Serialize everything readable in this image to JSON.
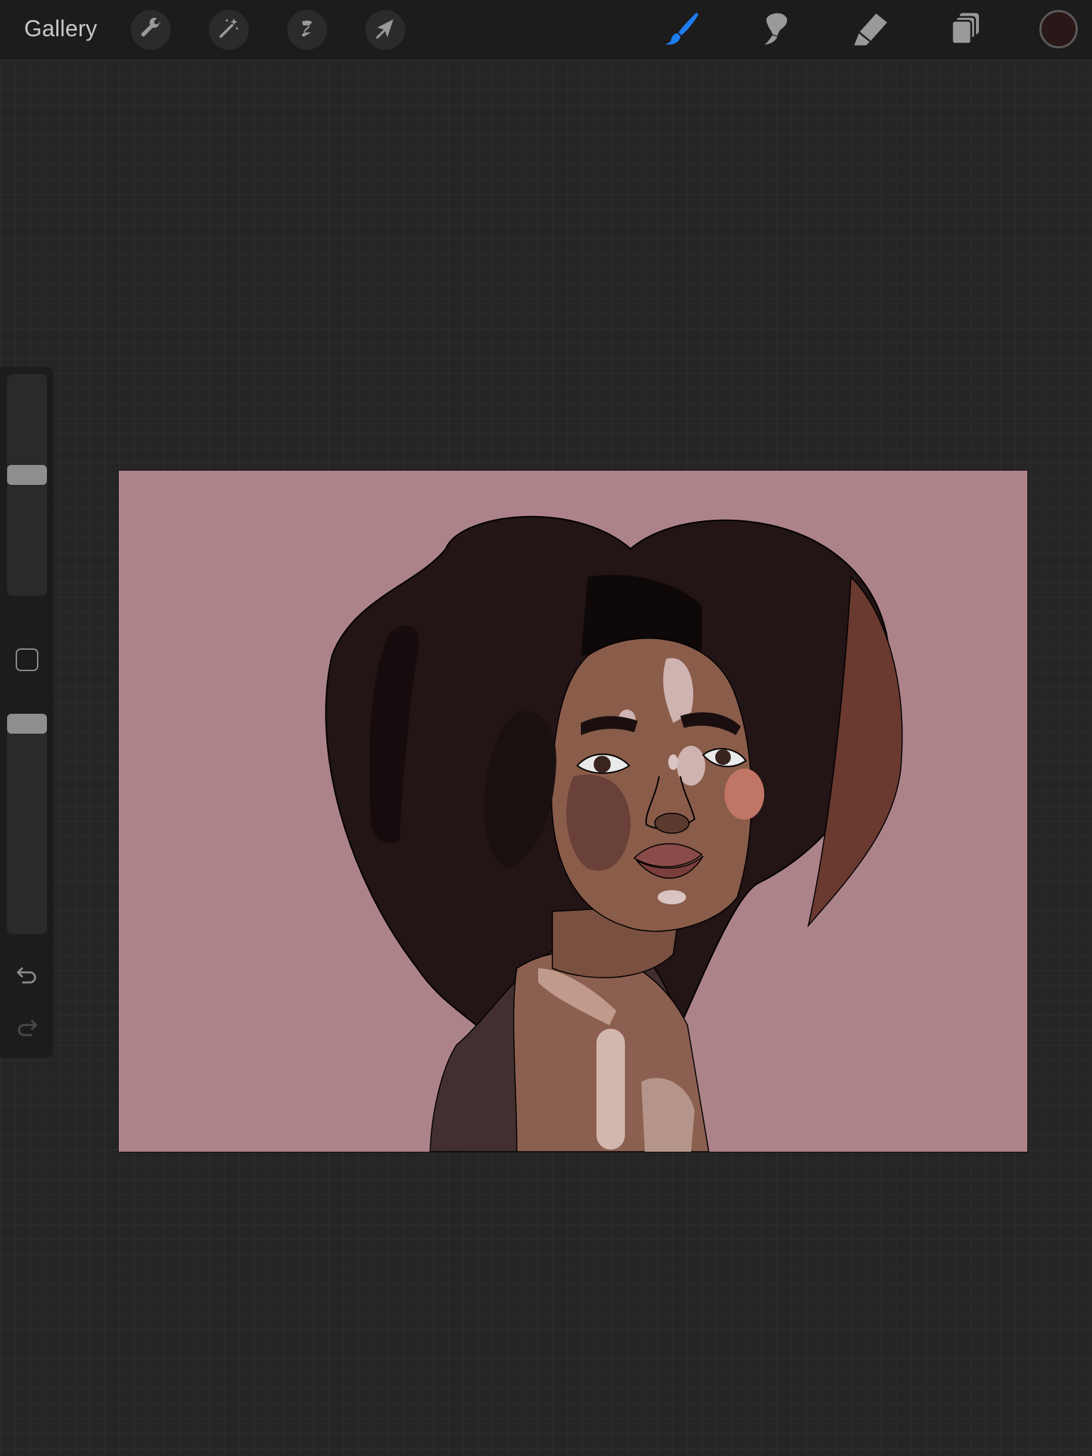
{
  "toolbar": {
    "gallery_label": "Gallery",
    "left_tools": [
      {
        "icon": "wrench-icon",
        "name": "actions"
      },
      {
        "icon": "magic-wand-icon",
        "name": "adjustments"
      },
      {
        "icon": "selection-icon",
        "name": "selection"
      },
      {
        "icon": "arrow-cursor-icon",
        "name": "transform"
      }
    ],
    "right_tools": [
      {
        "icon": "brush-icon",
        "name": "paint",
        "active": true
      },
      {
        "icon": "smudge-icon",
        "name": "smudge"
      },
      {
        "icon": "eraser-icon",
        "name": "erase"
      },
      {
        "icon": "layers-icon",
        "name": "layers"
      }
    ],
    "current_color": "#2a1718",
    "active_color": "#1e7cf0"
  },
  "sidebar": {
    "brush_size_level": 0.55,
    "opacity_level": 1.0,
    "icons": [
      "modify-square-icon",
      "undo-icon",
      "redo-icon"
    ]
  },
  "canvas": {
    "background_color": "#ad838a",
    "artwork": "illustration-portrait"
  }
}
